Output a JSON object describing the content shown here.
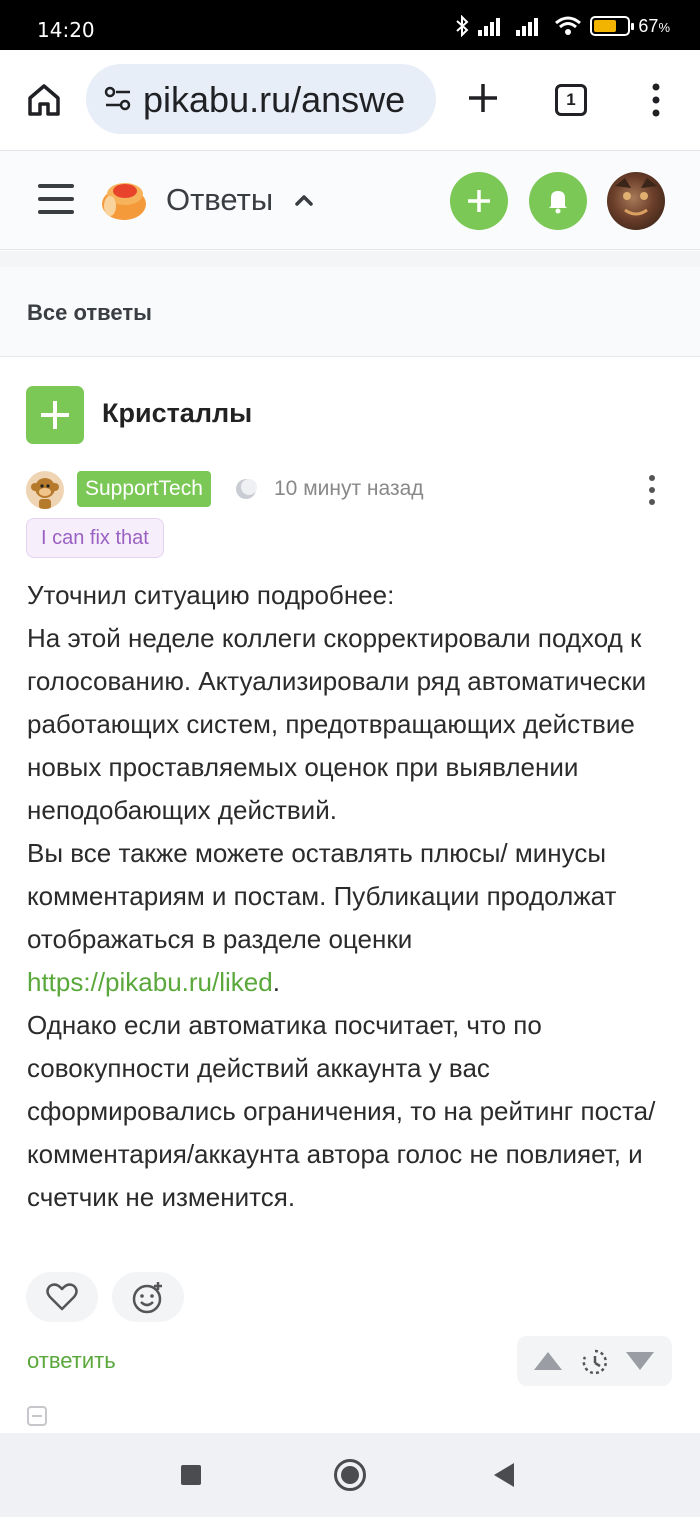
{
  "status_bar": {
    "time": "14:20",
    "battery": "67",
    "battery_suffix": "%",
    "battery_level": 0.67
  },
  "browser": {
    "url": "pikabu.ru/answe",
    "tab_count": "1",
    "icons": [
      "home-icon",
      "site-settings-icon",
      "new-tab-icon",
      "tabs-icon",
      "more-icon"
    ]
  },
  "header": {
    "section_title": "Ответы",
    "colors": {
      "accent": "#7bc856"
    }
  },
  "filter": {
    "label": "Все ответы"
  },
  "post": {
    "topic_title": "Кристаллы",
    "author": "SupportTech",
    "time_ago": "10 минут назад",
    "badge": "I can fix that",
    "paragraphs": [
      "Уточнил ситуацию подробнее:",
      "На этой неделе коллеги скорректировали подход к голосованию. Актуализировали ряд автоматически работающих систем, предотвращающих действие новых проставляемых оценок при выявлении неподобающих действий.",
      "Вы все также можете оставлять плюсы/ минусы комментариям и постам. Публикации продолжат отображаться в разделе оценки",
      "Однако если автоматика посчитает, что по совокупности действий аккаунта у вас сформировались ограничения, то на рейтинг поста/комментария/аккаунта автора голос не повлияет, и счетчик не изменится."
    ],
    "link": "https://pikabu.ru/liked",
    "link_suffix": ".",
    "reply_label": "ответить"
  }
}
